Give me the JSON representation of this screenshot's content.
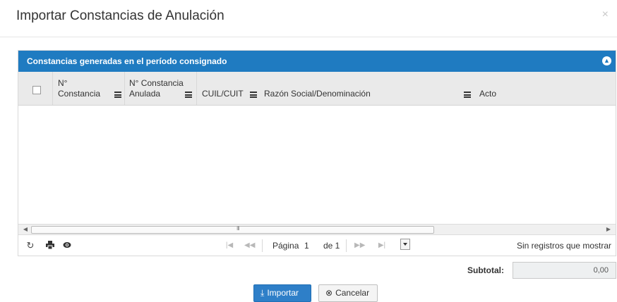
{
  "dialog": {
    "title": "Importar Constancias de Anulación",
    "close_label": "×"
  },
  "panel": {
    "heading": "Constancias generadas en el período consignado",
    "collapse_icon": "chevron-up-circle-icon",
    "accent_color": "#1f7bc1"
  },
  "grid": {
    "columns": [
      {
        "line1": "N°",
        "line2": "Constancia"
      },
      {
        "line1": "N° Constancia",
        "line2": "Anulada"
      },
      {
        "line1": "",
        "line2": "CUIL/CUIT"
      },
      {
        "line1": "",
        "line2": "Razón Social/Denominación"
      },
      {
        "line1": "",
        "line2": "Acto"
      }
    ],
    "rows": []
  },
  "scrollbar": {
    "left_arrow": "◀",
    "right_arrow": "▶",
    "grip": "III"
  },
  "pager": {
    "first_icon": "first-page-icon",
    "prev_icon": "prev-page-icon",
    "next_icon": "next-page-icon",
    "last_icon": "last-page-icon",
    "page_label": "Página",
    "page_value": "1",
    "of_label": "de 1",
    "empty_message": "Sin registros que mostrar"
  },
  "toolbar": {
    "refresh_icon": "refresh-icon",
    "print_icon": "print-icon",
    "view_icon": "eye-icon"
  },
  "summary": {
    "subtotal_label": "Subtotal:",
    "subtotal_value": "0,00"
  },
  "actions": {
    "import_label": "Importar",
    "cancel_label": "Cancelar",
    "primary_color": "#2e7fc8"
  }
}
